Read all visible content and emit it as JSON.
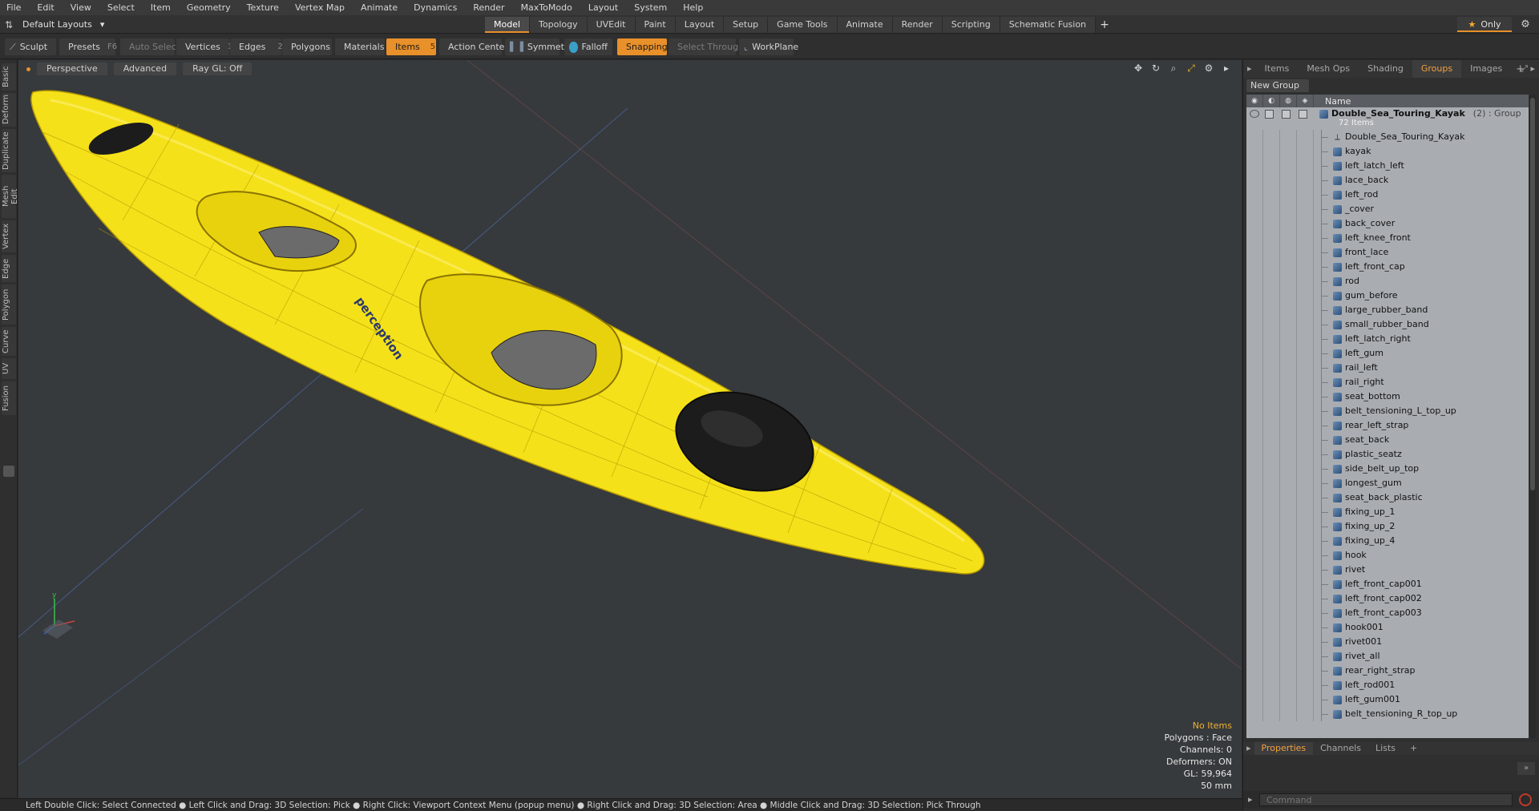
{
  "menu": [
    "File",
    "Edit",
    "View",
    "Select",
    "Item",
    "Geometry",
    "Texture",
    "Vertex Map",
    "Animate",
    "Dynamics",
    "Render",
    "MaxToModo",
    "Layout",
    "System",
    "Help"
  ],
  "layout_selector": "Default Layouts",
  "mode_tabs": [
    "Model",
    "Topology",
    "UVEdit",
    "Paint",
    "Layout",
    "Setup",
    "Game Tools",
    "Animate",
    "Render",
    "Scripting",
    "Schematic Fusion"
  ],
  "active_mode_tab": "Model",
  "only_button": "Only",
  "toolbar": {
    "sculpt": "Sculpt",
    "presets": "Presets",
    "presets_key": "F6",
    "auto_select": "Auto Select",
    "vertices": "Vertices",
    "vertices_count": "1",
    "edges": "Edges",
    "edges_count": "2",
    "polygons": "Polygons",
    "materials": "Materials",
    "items": "Items",
    "items_count": "5",
    "action_center": "Action Center",
    "symmetry": "Symmetry",
    "falloff": "Falloff",
    "snapping": "Snapping",
    "select_through": "Select Through",
    "workplane": "WorkPlane"
  },
  "left_tabs": [
    "Basic",
    "Deform",
    "Duplicate",
    "Mesh Edit",
    "Vertex",
    "Edge",
    "Polygon",
    "Curve",
    "UV",
    "Fusion"
  ],
  "viewport": {
    "view": "Perspective",
    "shading": "Advanced",
    "raygl": "Ray GL: Off",
    "logo_text": "perception",
    "stats": {
      "selection": "No Items",
      "polygons": "Polygons : Face",
      "channels": "Channels: 0",
      "deformers": "Deformers: ON",
      "gl": "GL: 59,964",
      "unit": "50 mm"
    },
    "colors": {
      "background": "#363a3c",
      "hull": "#f5e11a",
      "wire": "#b89a00",
      "cockpit": "#1c1c1c"
    }
  },
  "right_panel": {
    "tabs": [
      "Items",
      "Mesh Ops",
      "Shading",
      "Groups",
      "Images"
    ],
    "active_tab": "Groups",
    "new_group": "New Group",
    "name_header": "Name",
    "group": {
      "name": "Double_Sea_Touring_Kayak",
      "count": "(2) : Group",
      "sub": "72 Items"
    },
    "items": [
      "Double_Sea_Touring_Kayak",
      "kayak",
      "left_latch_left",
      "lace_back",
      "left_rod",
      "_cover",
      "back_cover",
      "left_knee_front",
      "front_lace",
      "left_front_cap",
      "rod",
      "gum_before",
      "large_rubber_band",
      "small_rubber_band",
      "left_latch_right",
      "left_gum",
      "rail_left",
      "rail_right",
      "seat_bottom",
      "belt_tensioning_L_top_up",
      "rear_left_strap",
      "seat_back",
      "plastic_seatz",
      "side_belt_up_top",
      "longest_gum",
      "seat_back_plastic",
      "fixing_up_1",
      "fixing_up_2",
      "fixing_up_4",
      "hook",
      "rivet",
      "left_front_cap001",
      "left_front_cap002",
      "left_front_cap003",
      "hook001",
      "rivet001",
      "rivet_all",
      "rear_right_strap",
      "left_rod001",
      "left_gum001",
      "belt_tensioning_R_top_up"
    ],
    "bottom_tabs": [
      "Properties",
      "Channels",
      "Lists"
    ],
    "active_bottom_tab": "Properties",
    "command_placeholder": "Command"
  },
  "status_bar": "Left Double Click: Select Connected ● Left Click and Drag: 3D Selection: Pick ● Right Click: Viewport Context Menu (popup menu) ● Right Click and Drag: 3D Selection: Area ● Middle Click and Drag: 3D Selection: Pick Through"
}
